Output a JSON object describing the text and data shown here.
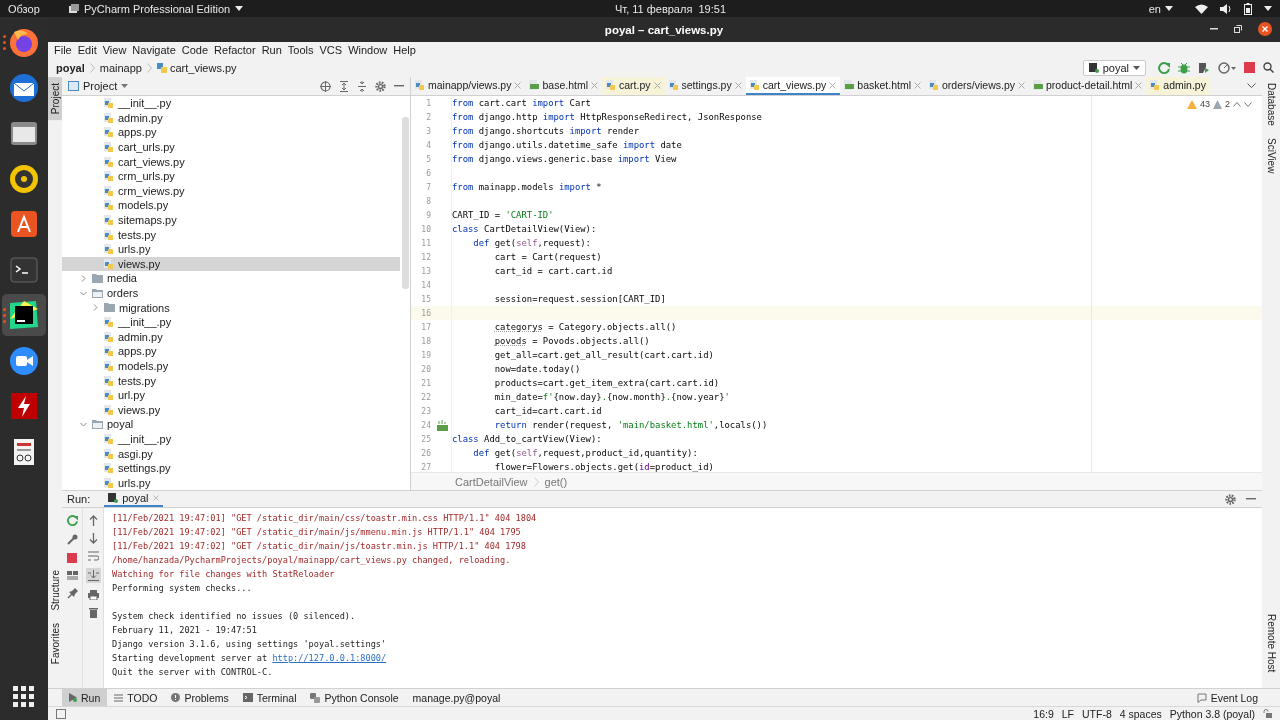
{
  "system_bar": {
    "activities": "Обзор",
    "app_menu": "PyCharm Professional Edition",
    "clock": "Чт, 11 февраля  19:51",
    "language": "en"
  },
  "dock": [
    {
      "kind": "browser",
      "running": true,
      "active": false
    },
    {
      "kind": "mail",
      "running": false,
      "active": false
    },
    {
      "kind": "files",
      "running": false,
      "active": false
    },
    {
      "kind": "music",
      "running": false,
      "active": false
    },
    {
      "kind": "store",
      "running": false,
      "active": false
    },
    {
      "kind": "terminal",
      "running": false,
      "active": false
    },
    {
      "kind": "ide",
      "running": true,
      "active": true
    },
    {
      "kind": "video",
      "running": false,
      "active": false
    },
    {
      "kind": "ftp",
      "running": false,
      "active": false
    },
    {
      "kind": "document",
      "running": false,
      "active": false
    }
  ],
  "window": {
    "title": "poyal – cart_views.py"
  },
  "menu": [
    "File",
    "Edit",
    "View",
    "Navigate",
    "Code",
    "Refactor",
    "Run",
    "Tools",
    "VCS",
    "Window",
    "Help"
  ],
  "breadcrumb": [
    "poyal",
    "mainapp",
    "cart_views.py"
  ],
  "run_config": {
    "label": "poyal"
  },
  "left_strip": {
    "top": [
      {
        "label": "Project",
        "selected": true
      }
    ],
    "bottom": [
      {
        "label": "Structure",
        "selected": false
      },
      {
        "label": "Favorites",
        "selected": false
      }
    ]
  },
  "right_strip": {
    "top": [
      "Database",
      "SciView"
    ],
    "bottom": [
      "Remote Host"
    ]
  },
  "project_panel": {
    "title": "Project",
    "tree": [
      {
        "children": [
          {
            "label": "__init__.py",
            "kind": "file",
            "selected": false
          },
          {
            "label": "admin.py",
            "kind": "file",
            "selected": false
          },
          {
            "label": "apps.py",
            "kind": "file",
            "selected": false
          },
          {
            "label": "cart_urls.py",
            "kind": "file",
            "selected": false
          },
          {
            "label": "cart_views.py",
            "kind": "file",
            "selected": false
          },
          {
            "label": "crm_urls.py",
            "kind": "file",
            "selected": false
          },
          {
            "label": "crm_views.py",
            "kind": "file",
            "selected": false
          },
          {
            "label": "models.py",
            "kind": "file",
            "selected": false
          },
          {
            "label": "sitemaps.py",
            "kind": "file",
            "selected": false
          },
          {
            "label": "tests.py",
            "kind": "file",
            "selected": false
          },
          {
            "label": "urls.py",
            "kind": "file",
            "selected": false
          },
          {
            "label": "views.py",
            "kind": "file",
            "selected": true
          }
        ]
      },
      {
        "label": "media",
        "kind": "folder",
        "expanded": false,
        "selected": false
      },
      {
        "label": "orders",
        "kind": "folder",
        "expanded": true,
        "selected": false,
        "children": [
          {
            "label": "migrations",
            "kind": "folder",
            "expanded": false,
            "selected": false
          },
          {
            "label": "__init__.py",
            "kind": "file",
            "selected": false
          },
          {
            "label": "admin.py",
            "kind": "file",
            "selected": false
          },
          {
            "label": "apps.py",
            "kind": "file",
            "selected": false
          },
          {
            "label": "models.py",
            "kind": "file",
            "selected": false
          },
          {
            "label": "tests.py",
            "kind": "file",
            "selected": false
          },
          {
            "label": "url.py",
            "kind": "file",
            "selected": false
          },
          {
            "label": "views.py",
            "kind": "file",
            "selected": false
          }
        ]
      },
      {
        "label": "poyal",
        "kind": "folder",
        "expanded": true,
        "selected": false,
        "children": [
          {
            "label": "__init__.py",
            "kind": "file",
            "selected": false
          },
          {
            "label": "asgi.py",
            "kind": "file",
            "selected": false
          },
          {
            "label": "settings.py",
            "kind": "file",
            "selected": false
          },
          {
            "label": "urls.py",
            "kind": "file",
            "selected": false
          }
        ]
      }
    ]
  },
  "editor": {
    "tabs": [
      {
        "label": "mainapp/views.py",
        "kind": "py",
        "selected": false,
        "tinted": false,
        "closable": true
      },
      {
        "label": "base.html",
        "kind": "html",
        "selected": false,
        "tinted": false,
        "closable": true
      },
      {
        "label": "cart.py",
        "kind": "py",
        "selected": false,
        "tinted": true,
        "closable": true
      },
      {
        "label": "settings.py",
        "kind": "py",
        "selected": false,
        "tinted": false,
        "closable": true
      },
      {
        "label": "cart_views.py",
        "kind": "py",
        "selected": true,
        "tinted": false,
        "closable": true
      },
      {
        "label": "basket.html",
        "kind": "html",
        "selected": false,
        "tinted": false,
        "closable": true
      },
      {
        "label": "orders/views.py",
        "kind": "py",
        "selected": false,
        "tinted": false,
        "closable": true
      },
      {
        "label": "product-detail.html",
        "kind": "html",
        "selected": false,
        "tinted": false,
        "closable": true
      },
      {
        "label": "admin.py",
        "kind": "py",
        "selected": false,
        "tinted": true,
        "closable": false
      }
    ],
    "inspections": {
      "warnings": "43",
      "weak_warnings": "2"
    },
    "lines": [
      {
        "n": "1",
        "current": false,
        "tokens": [
          {
            "kind": "kw",
            "text": "from"
          },
          {
            "kind": "plain",
            "text": " cart.cart "
          },
          {
            "kind": "kw",
            "text": "import"
          },
          {
            "kind": "plain",
            "text": " Cart"
          }
        ]
      },
      {
        "n": "2",
        "current": false,
        "tokens": [
          {
            "kind": "kw",
            "text": "from"
          },
          {
            "kind": "plain",
            "text": " django.http "
          },
          {
            "kind": "kw",
            "text": "import"
          },
          {
            "kind": "plain",
            "text": " HttpResponseRedirect, JsonResponse"
          }
        ]
      },
      {
        "n": "3",
        "current": false,
        "tokens": [
          {
            "kind": "kw",
            "text": "from"
          },
          {
            "kind": "plain",
            "text": " django.shortcuts "
          },
          {
            "kind": "kw",
            "text": "import"
          },
          {
            "kind": "plain",
            "text": " render"
          }
        ]
      },
      {
        "n": "4",
        "current": false,
        "tokens": [
          {
            "kind": "kw",
            "text": "from"
          },
          {
            "kind": "plain",
            "text": " django.utils.datetime_safe "
          },
          {
            "kind": "kw",
            "text": "import"
          },
          {
            "kind": "plain",
            "text": " date"
          }
        ]
      },
      {
        "n": "5",
        "current": false,
        "tokens": [
          {
            "kind": "kw",
            "text": "from"
          },
          {
            "kind": "plain",
            "text": " django.views.generic.base "
          },
          {
            "kind": "kw",
            "text": "import"
          },
          {
            "kind": "plain",
            "text": " View"
          }
        ]
      },
      {
        "n": "6",
        "current": false
      },
      {
        "n": "7",
        "current": false,
        "tokens": [
          {
            "kind": "kw",
            "text": "from"
          },
          {
            "kind": "plain",
            "text": " mainapp.models "
          },
          {
            "kind": "kw",
            "text": "import"
          },
          {
            "kind": "plain",
            "text": " *"
          }
        ]
      },
      {
        "n": "8",
        "current": false
      },
      {
        "n": "9",
        "current": false,
        "tokens": [
          {
            "kind": "plain",
            "text": "CART_ID = "
          },
          {
            "kind": "str",
            "text": "'CART-ID'"
          }
        ]
      },
      {
        "n": "10",
        "current": false,
        "tokens": [
          {
            "kind": "kw",
            "text": "class"
          },
          {
            "kind": "plain",
            "text": " CartDetailView(View):"
          }
        ]
      },
      {
        "n": "11",
        "current": false,
        "tokens": [
          {
            "kind": "kw",
            "text": "    def"
          },
          {
            "kind": "plain",
            "text": " get("
          },
          {
            "kind": "self",
            "text": "self"
          },
          {
            "kind": "plain",
            "text": ",request):"
          }
        ]
      },
      {
        "n": "12",
        "current": false,
        "tokens": [
          {
            "kind": "plain",
            "text": "        cart = Cart(request)"
          }
        ]
      },
      {
        "n": "13",
        "current": false,
        "tokens": [
          {
            "kind": "plain",
            "text": "        cart_id = cart.cart.id"
          }
        ]
      },
      {
        "n": "14",
        "current": false
      },
      {
        "n": "15",
        "current": false,
        "tokens": [
          {
            "kind": "plain",
            "text": "        session=request.session[CART_ID]"
          }
        ]
      },
      {
        "n": "16",
        "current": true
      },
      {
        "n": "17",
        "current": false,
        "tokens": [
          {
            "kind": "warn",
            "text": "        categorys"
          },
          {
            "kind": "plain",
            "text": " = Category.objects.all()"
          }
        ]
      },
      {
        "n": "18",
        "current": false,
        "tokens": [
          {
            "kind": "warn",
            "text": "        povods"
          },
          {
            "kind": "plain",
            "text": " = Povods.objects.all()"
          }
        ]
      },
      {
        "n": "19",
        "current": false,
        "tokens": [
          {
            "kind": "plain",
            "text": "        get_all=cart.get_all_result(cart.cart.id)"
          }
        ]
      },
      {
        "n": "20",
        "current": false,
        "tokens": [
          {
            "kind": "plain",
            "text": "        now=date.today()"
          }
        ]
      },
      {
        "n": "21",
        "current": false,
        "tokens": [
          {
            "kind": "plain",
            "text": "        products=cart.get_item_extra(cart.cart.id)"
          }
        ]
      },
      {
        "n": "22",
        "current": false,
        "tokens": [
          {
            "kind": "plain",
            "text": "        min_date="
          },
          {
            "kind": "str",
            "text": "f'"
          },
          {
            "kind": "plain",
            "text": "{now.day}"
          },
          {
            "kind": "str",
            "text": "."
          },
          {
            "kind": "plain",
            "text": "{now.month}"
          },
          {
            "kind": "str",
            "text": "."
          },
          {
            "kind": "plain",
            "text": "{now.year}"
          },
          {
            "kind": "str",
            "text": "'"
          }
        ]
      },
      {
        "n": "23",
        "current": false,
        "tokens": [
          {
            "kind": "plain",
            "text": "        cart_id=cart.cart.id"
          }
        ]
      },
      {
        "n": "24",
        "current": false,
        "gutter": {
          "kind": "template"
        },
        "tokens": [
          {
            "kind": "kw",
            "text": "        return"
          },
          {
            "kind": "plain",
            "text": " render(request, "
          },
          {
            "kind": "str",
            "text": "'main/basket.html'"
          },
          {
            "kind": "plain",
            "text": ",locals())"
          }
        ]
      },
      {
        "n": "25",
        "current": false,
        "tokens": [
          {
            "kind": "kw",
            "text": "class"
          },
          {
            "kind": "plain",
            "text": " Add_to_cartView(View):"
          }
        ]
      },
      {
        "n": "26",
        "current": false,
        "tokens": [
          {
            "kind": "kw",
            "text": "    def"
          },
          {
            "kind": "plain",
            "text": " get("
          },
          {
            "kind": "self",
            "text": "self"
          },
          {
            "kind": "plain",
            "text": ",request,product_id,quantity):"
          }
        ]
      },
      {
        "n": "27",
        "current": false,
        "tokens": [
          {
            "kind": "plain",
            "text": "        flower=Flowers.objects.get("
          },
          {
            "kind": "param",
            "text": "id"
          },
          {
            "kind": "plain",
            "text": "=product_id)"
          }
        ]
      }
    ],
    "breadcrumb": [
      "CartDetailView",
      "get()"
    ]
  },
  "run_panel": {
    "title": "Run:",
    "tab": "poyal",
    "lines": [
      {
        "kind": "error",
        "text": "[11/Feb/2021 19:47:01] \"GET /static_dir/main/css/toastr.min.css HTTP/1.1\" 404 1804"
      },
      {
        "kind": "error",
        "text": "[11/Feb/2021 19:47:02] \"GET /static_dir/main/js/mmenu.min.js HTTP/1.1\" 404 1795"
      },
      {
        "kind": "error",
        "text": "[11/Feb/2021 19:47:02] \"GET /static_dir/main/js/toastr.min.js HTTP/1.1\" 404 1798"
      },
      {
        "kind": "error",
        "text": "/home/hanzada/PycharmProjects/poyal/mainapp/cart_views.py changed, reloading."
      },
      {
        "kind": "error",
        "text": "Watching for file changes with StatReloader"
      },
      {
        "kind": "normal",
        "text": "Performing system checks..."
      },
      {
        "kind": "blank"
      },
      {
        "kind": "normal",
        "text": "System check identified no issues (0 silenced)."
      },
      {
        "kind": "normal",
        "text": "February 11, 2021 - 19:47:51"
      },
      {
        "kind": "normal",
        "text": "Django version 3.1.6, using settings 'poyal.settings'"
      },
      {
        "kind": "normal",
        "text": "Starting development server at ",
        "link": "http://127.0.0.1:8000/"
      },
      {
        "kind": "normal",
        "text": "Quit the server with CONTROL-C."
      }
    ]
  },
  "tool_tabs": [
    {
      "label": "Run",
      "kind": "run",
      "selected": true
    },
    {
      "label": "TODO",
      "kind": "list",
      "selected": false
    },
    {
      "label": "Problems",
      "kind": "problems",
      "selected": false
    },
    {
      "label": "Terminal",
      "kind": "terminal",
      "selected": false
    },
    {
      "label": "Python Console",
      "kind": "console",
      "selected": false
    },
    {
      "label": "manage.py@poyal",
      "kind": "plain",
      "selected": false
    }
  ],
  "event_log": "Event Log",
  "status": [
    "16:9",
    "LF",
    "UTF-8",
    "4 spaces",
    "Python 3.8 (poyal)"
  ]
}
